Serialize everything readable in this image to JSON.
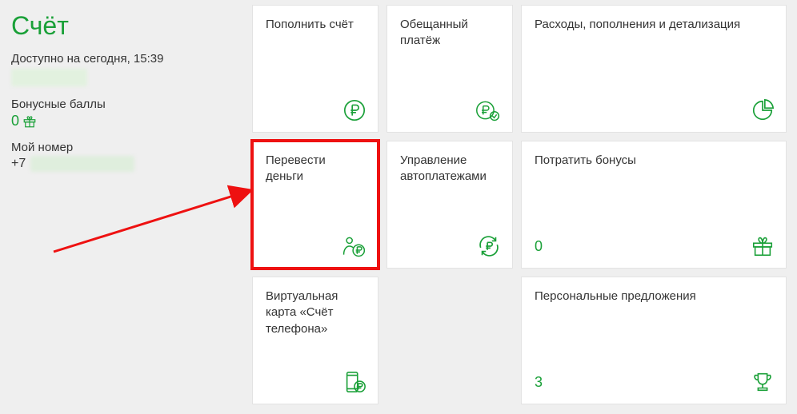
{
  "sidebar": {
    "title": "Счёт",
    "available_label": "Доступно на сегодня, 15:39",
    "bonus_label": "Бонусные баллы",
    "bonus_value": "0",
    "phone_label": "Мой номер",
    "phone_prefix": "+7"
  },
  "cards": {
    "topup": {
      "title": "Пополнить счёт"
    },
    "promised": {
      "title": "Обещанный платёж"
    },
    "expenses": {
      "title": "Расходы, пополнения и детализация"
    },
    "transfer": {
      "title": "Перевести деньги"
    },
    "autopay": {
      "title": "Управление автоплатежами"
    },
    "spend_bonus": {
      "title": "Потратить бонусы",
      "value": "0"
    },
    "virtual_card": {
      "title": "Виртуальная карта «Счёт телефона»"
    },
    "offers": {
      "title": "Персональные предложения",
      "value": "3"
    }
  },
  "colors": {
    "accent": "#1aa038"
  }
}
